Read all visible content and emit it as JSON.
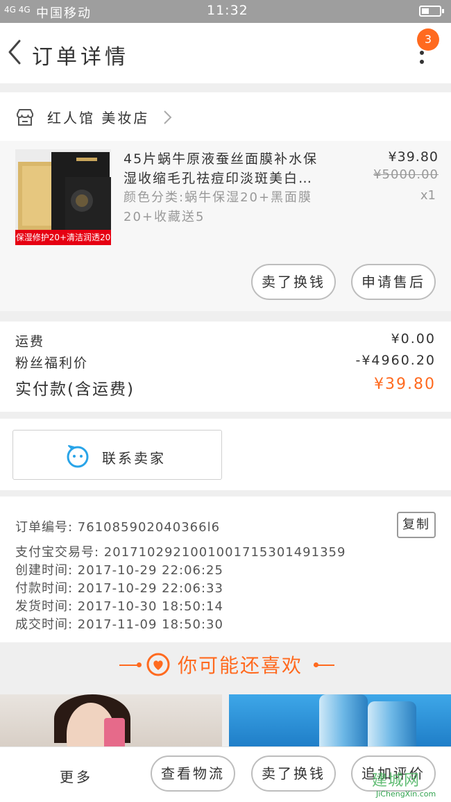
{
  "status_bar": {
    "signal": "4G 4G",
    "carrier": "中国移动",
    "time": "11:32"
  },
  "header": {
    "title": "订单详情",
    "badge_count": "3"
  },
  "store": {
    "name": "红人馆 美妆店"
  },
  "product": {
    "thumb_ribbon": "保湿修护20+清洁润透20",
    "title": "45片蜗牛原液蚕丝面膜补水保湿收缩毛孔祛痘印淡斑美白…",
    "variant": "颜色分类:蜗牛保湿20+黑面膜20+收藏送5",
    "price": "¥39.80",
    "original_price": "¥5000.00",
    "quantity": "x1",
    "actions": [
      "卖了换钱",
      "申请售后"
    ]
  },
  "fees": [
    {
      "label": "运费",
      "value": "¥0.00"
    },
    {
      "label": "粉丝福利价",
      "value": "-¥4960.20"
    },
    {
      "label": "实付款(含运费)",
      "value": "¥39.80"
    }
  ],
  "contact": {
    "label": "联系卖家"
  },
  "order_info": {
    "order_no": "订单编号: 761085902040366l6",
    "copy_label": "复制",
    "lines": [
      "支付宝交易号: 2017102921001001715301491359",
      "创建时间: 2017-10-29 22:06:25",
      "付款时间: 2017-10-29 22:06:33",
      "发货时间: 2017-10-30 18:50:14",
      "成交时间: 2017-11-09 18:50:30"
    ]
  },
  "recommend": {
    "title": "你可能还喜欢"
  },
  "bottom_bar": {
    "more_label": "更多",
    "buttons": [
      "查看物流",
      "卖了换钱",
      "追加评价"
    ],
    "watermark_big": "建城网",
    "watermark_url": "JiChengXin.com"
  },
  "colors": {
    "accent": "#ff6a1f",
    "chat_blue": "#29a4e8",
    "text": "#333333",
    "muted": "#999999"
  }
}
